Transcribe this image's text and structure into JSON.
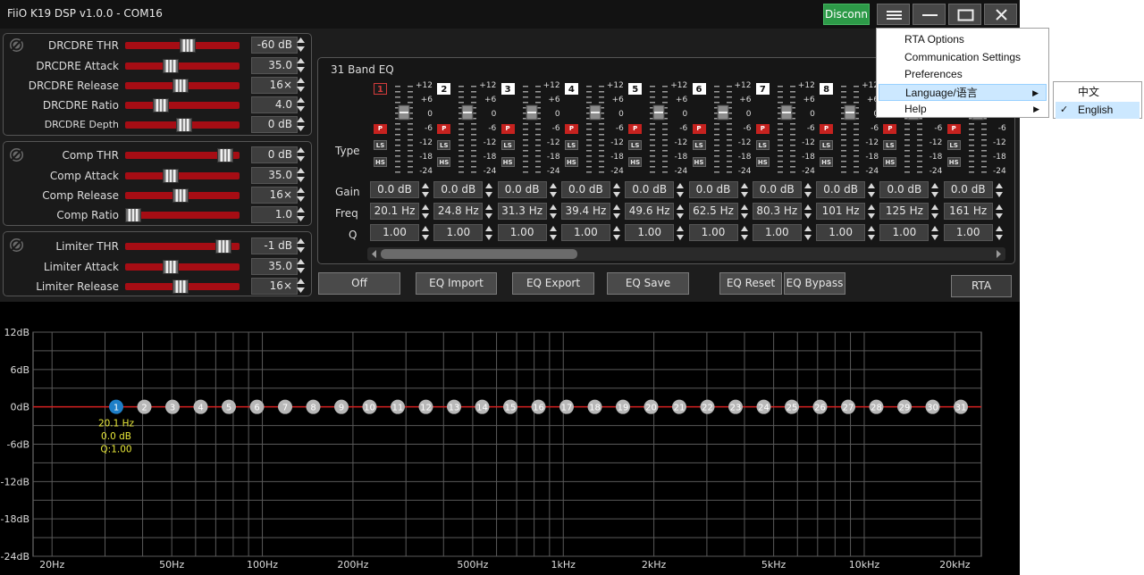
{
  "window": {
    "title": "FiiO K19 DSP v1.0.0 - COM16",
    "disconnect_label": "Disconn",
    "buttons": [
      "menu-icon",
      "minimize-icon",
      "maximize-icon",
      "close-icon"
    ]
  },
  "drc": {
    "rows": [
      {
        "label": "DRCDRE THR",
        "value": "-60 dB",
        "level": 0.55
      },
      {
        "label": "DRCDRE Attack",
        "value": "35.0 ms",
        "level": 0.38
      },
      {
        "label": "DRCDRE Release",
        "value": "16×",
        "level": 0.48
      },
      {
        "label": "DRCDRE Ratio",
        "value": "4.0",
        "level": 0.28
      },
      {
        "label": "DRCDRE Depth",
        "value": "0 dB",
        "level": 0.52
      }
    ]
  },
  "comp": {
    "rows": [
      {
        "label": "Comp THR",
        "value": "0 dB",
        "level": 0.94
      },
      {
        "label": "Comp Attack",
        "value": "35.0 ms",
        "level": 0.38
      },
      {
        "label": "Comp Release",
        "value": "16×",
        "level": 0.48
      },
      {
        "label": "Comp Ratio",
        "value": "1.0",
        "level": 0.0
      }
    ]
  },
  "limiter": {
    "rows": [
      {
        "label": "Limiter THR",
        "value": "-1 dB",
        "level": 0.92
      },
      {
        "label": "Limiter Attack",
        "value": "35.0 ms",
        "level": 0.38
      },
      {
        "label": "Limiter Release",
        "value": "16×",
        "level": 0.48
      }
    ]
  },
  "eq": {
    "title": "31 Band EQ",
    "row_labels": {
      "type": "Type",
      "gain": "Gain",
      "freq": "Freq",
      "q": "Q"
    },
    "scale": [
      "+12",
      "+6",
      "0",
      "-6",
      "-12",
      "-18",
      "-24"
    ],
    "type_labels": {
      "peak": "P",
      "low_shelf": "LS",
      "high_shelf": "HS"
    },
    "bands": [
      {
        "num": "1",
        "gain": "0.0 dB",
        "freq": "20.1 Hz",
        "q": "1.00",
        "selected": true
      },
      {
        "num": "2",
        "gain": "0.0 dB",
        "freq": "24.8 Hz",
        "q": "1.00"
      },
      {
        "num": "3",
        "gain": "0.0 dB",
        "freq": "31.3 Hz",
        "q": "1.00"
      },
      {
        "num": "4",
        "gain": "0.0 dB",
        "freq": "39.4 Hz",
        "q": "1.00"
      },
      {
        "num": "5",
        "gain": "0.0 dB",
        "freq": "49.6 Hz",
        "q": "1.00"
      },
      {
        "num": "6",
        "gain": "0.0 dB",
        "freq": "62.5 Hz",
        "q": "1.00"
      },
      {
        "num": "7",
        "gain": "0.0 dB",
        "freq": "80.3 Hz",
        "q": "1.00"
      },
      {
        "num": "8",
        "gain": "0.0 dB",
        "freq": "101 Hz",
        "q": "1.00"
      },
      {
        "num": "",
        "gain": "0.0 dB",
        "freq": "125 Hz",
        "q": "1.00"
      },
      {
        "num": "",
        "gain": "0.0 dB",
        "freq": "161 Hz",
        "q": "1.00"
      }
    ]
  },
  "actions": {
    "off": "Off",
    "import": "EQ Import",
    "export": "EQ Export",
    "save": "EQ Save",
    "reset": "EQ Reset",
    "bypass": "EQ Bypass",
    "rta": "RTA"
  },
  "graph": {
    "y_labels": [
      "12dB",
      "6dB",
      "0dB",
      "-6dB",
      "-12dB",
      "-18dB",
      "-24dB"
    ],
    "x_labels": [
      {
        "label": "20Hz",
        "hz": 20
      },
      {
        "label": "50Hz",
        "hz": 50
      },
      {
        "label": "100Hz",
        "hz": 100
      },
      {
        "label": "200Hz",
        "hz": 200
      },
      {
        "label": "500Hz",
        "hz": 500
      },
      {
        "label": "1kHz",
        "hz": 1000
      },
      {
        "label": "2kHz",
        "hz": 2000
      },
      {
        "label": "5kHz",
        "hz": 5000
      },
      {
        "label": "10kHz",
        "hz": 10000
      },
      {
        "label": "20kHz",
        "hz": 20000
      }
    ],
    "points": [
      "1",
      "2",
      "3",
      "4",
      "5",
      "6",
      "7",
      "8",
      "9",
      "10",
      "11",
      "12",
      "13",
      "14",
      "15",
      "16",
      "17",
      "18",
      "19",
      "20",
      "21",
      "22",
      "23",
      "24",
      "25",
      "26",
      "27",
      "28",
      "29",
      "30",
      "31"
    ],
    "selected_info": {
      "freq": "20.1 Hz",
      "gain": "0.0 dB",
      "q": "Q:1.00"
    },
    "colors": {
      "curve": "#d42020",
      "selected_point": "#1e7fc8",
      "point": "#b8b8b8",
      "info_text": "#e8e838"
    }
  },
  "menu": {
    "items": [
      {
        "label": "RTA Options"
      },
      {
        "label": "Communication Settings"
      },
      {
        "label": "Preferences"
      },
      {
        "label": "Language/语言",
        "submenu": true,
        "highlighted": true
      },
      {
        "label": "Help",
        "submenu": true
      }
    ],
    "submenu": [
      {
        "label": "中文"
      },
      {
        "label": "English",
        "checked": true
      }
    ]
  }
}
